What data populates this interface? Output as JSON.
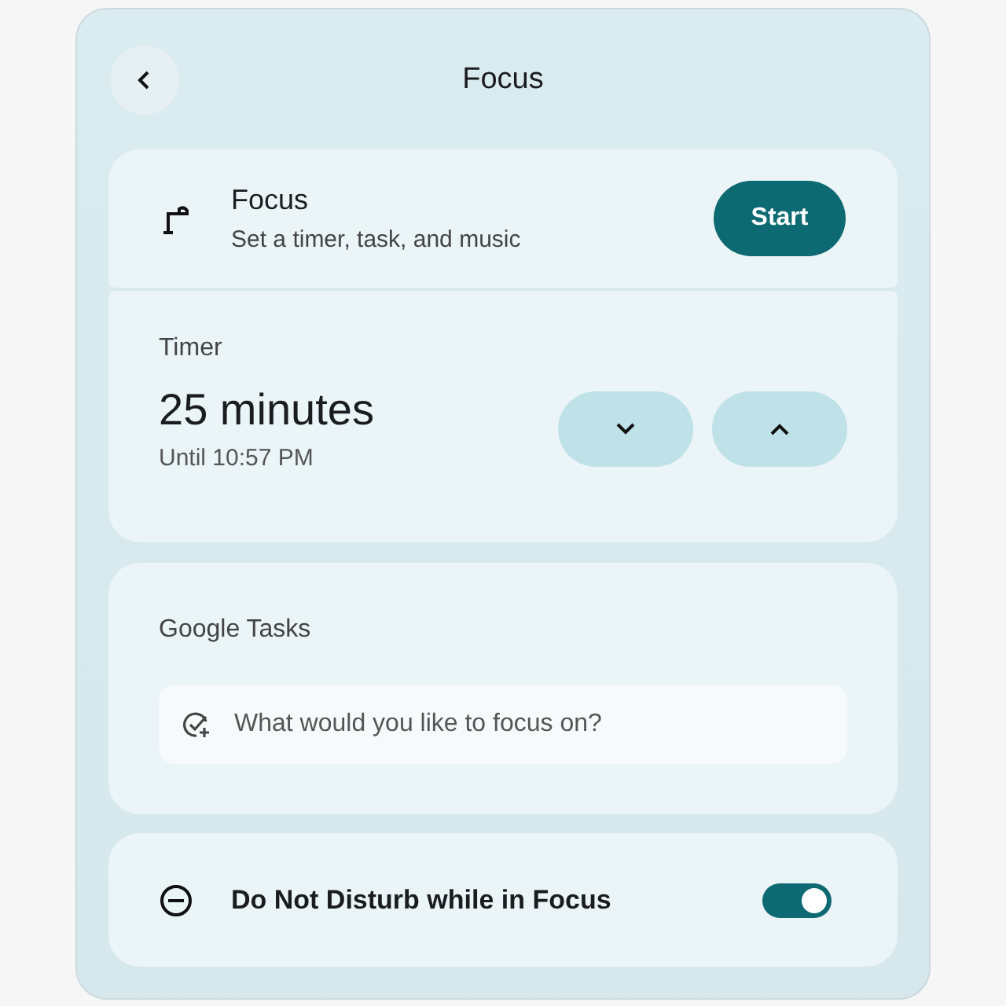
{
  "header": {
    "title": "Focus"
  },
  "focus": {
    "title": "Focus",
    "subtitle": "Set a timer, task, and music",
    "button": "Start"
  },
  "timer": {
    "label": "Timer",
    "value": "25 minutes",
    "until": "Until 10:57 PM"
  },
  "tasks": {
    "label": "Google Tasks",
    "placeholder": "What would you like to focus on?"
  },
  "dnd": {
    "label": "Do Not Disturb while in Focus",
    "on": true
  }
}
